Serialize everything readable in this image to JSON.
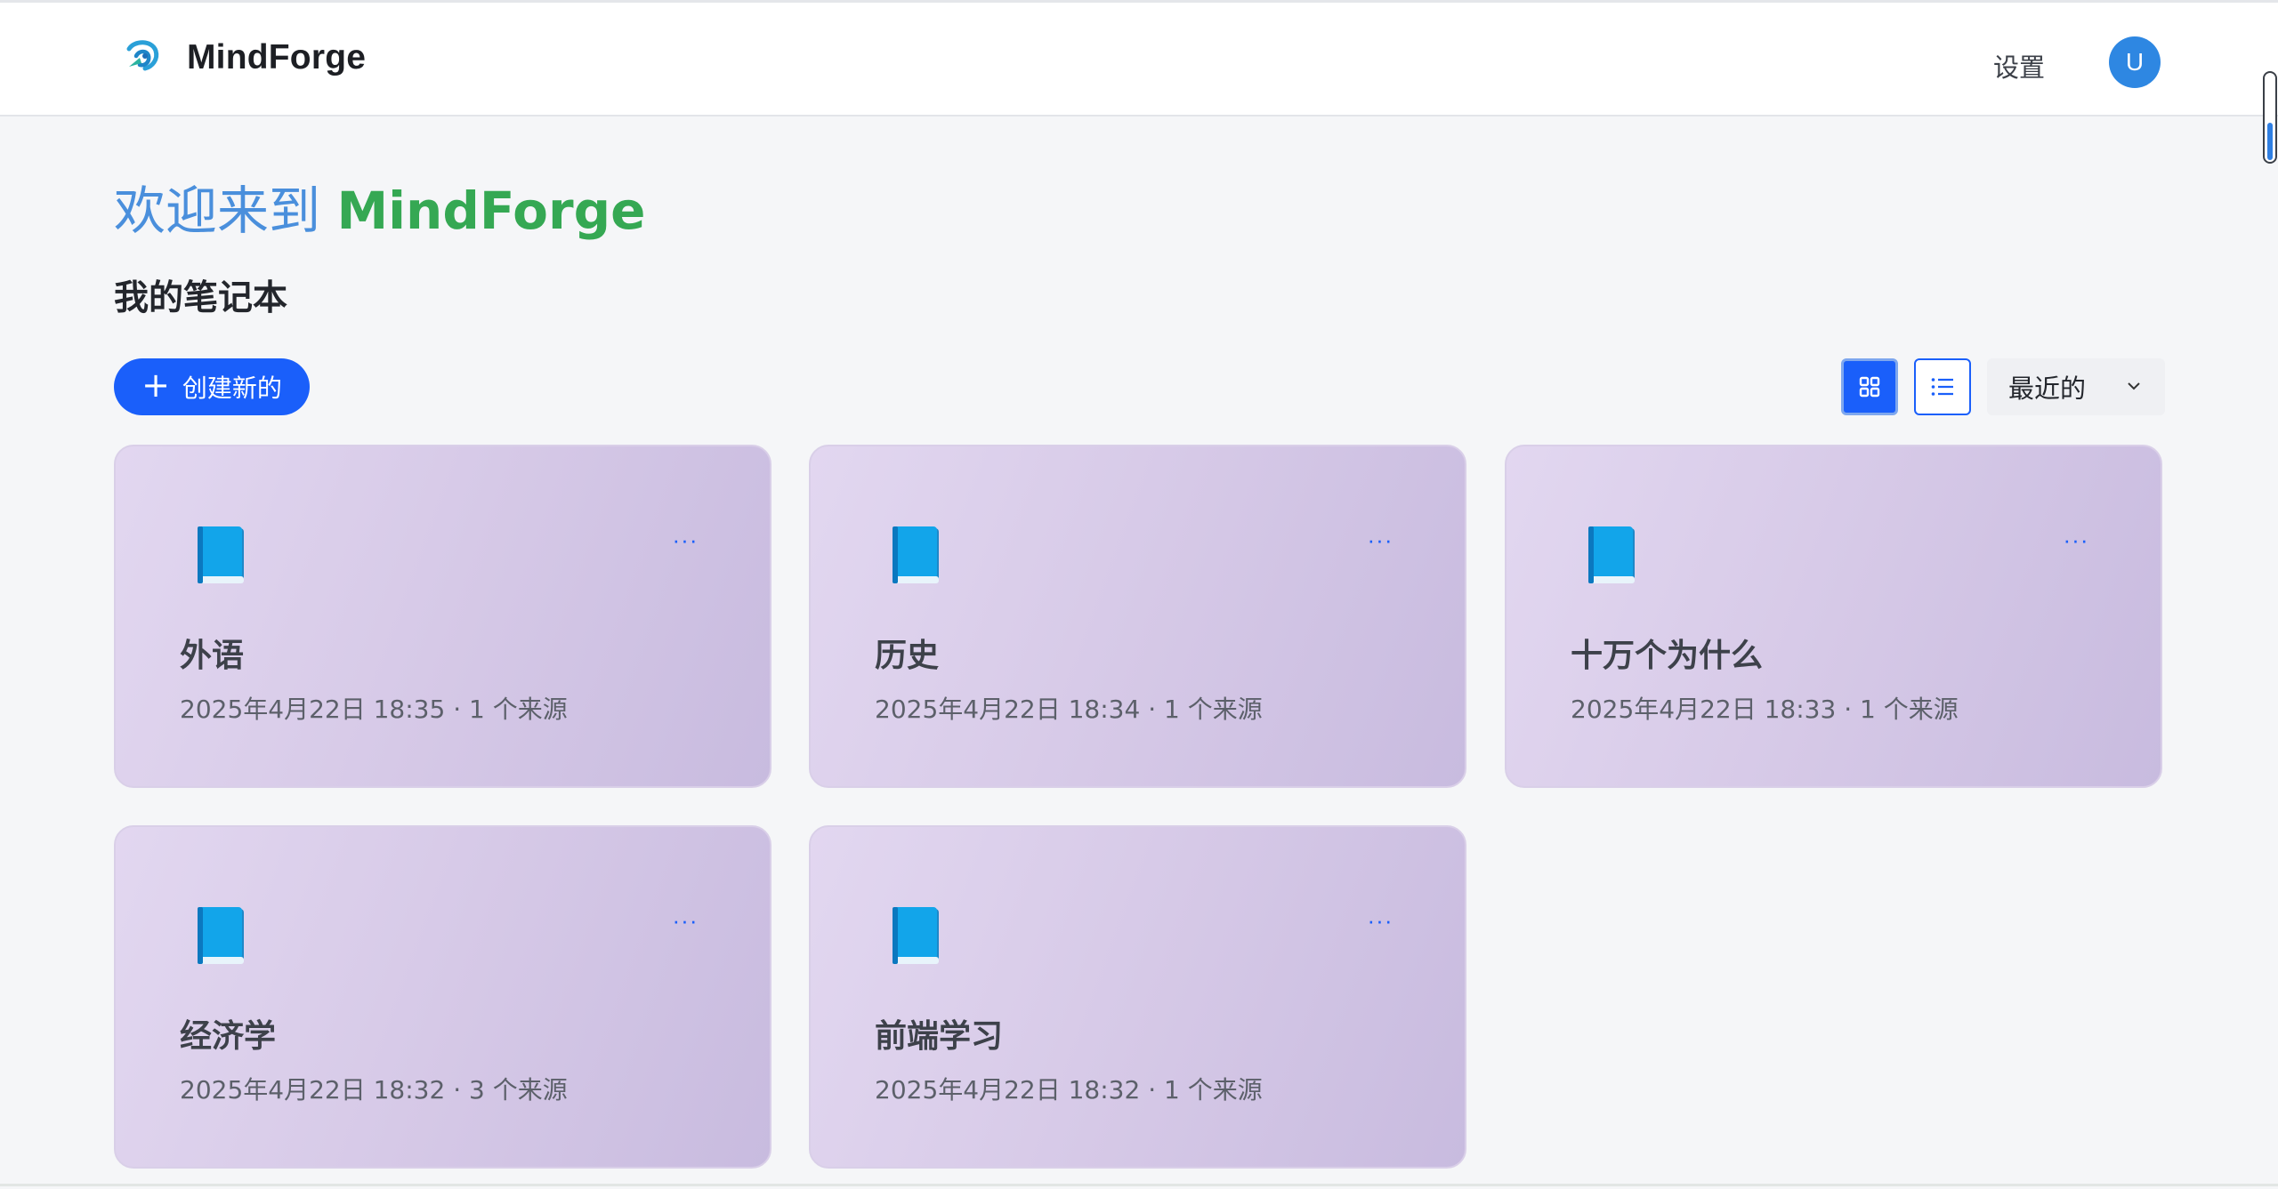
{
  "header": {
    "brand": "MindForge",
    "settings_label": "设置",
    "avatar_initial": "U"
  },
  "welcome": {
    "prefix": "欢迎来到 ",
    "brand": "MindForge"
  },
  "section_title": "我的笔记本",
  "toolbar": {
    "create_label": "创建新的",
    "sort_value": "最近的",
    "active_view": "grid"
  },
  "notebooks": [
    {
      "icon": "blue-book-icon",
      "title": "外语",
      "meta": "2025年4月22日 18:35 · 1 个来源"
    },
    {
      "icon": "blue-book-icon",
      "title": "历史",
      "meta": "2025年4月22日 18:34 · 1 个来源"
    },
    {
      "icon": "blue-book-icon",
      "title": "十万个为什么",
      "meta": "2025年4月22日 18:33 · 1 个来源"
    },
    {
      "icon": "blue-book-icon",
      "title": "经济学",
      "meta": "2025年4月22日 18:32 · 3 个来源"
    },
    {
      "icon": "blue-book-icon",
      "title": "前端学习",
      "meta": "2025年4月22日 18:32 · 1 个来源"
    }
  ],
  "colors": {
    "primary": "#1a5ffa",
    "welcome_prefix": "#4a8fdc",
    "welcome_brand": "#35a853",
    "avatar": "#2e87e2",
    "card_start": "#e2d7f0",
    "card_end": "#c8bbdf"
  }
}
